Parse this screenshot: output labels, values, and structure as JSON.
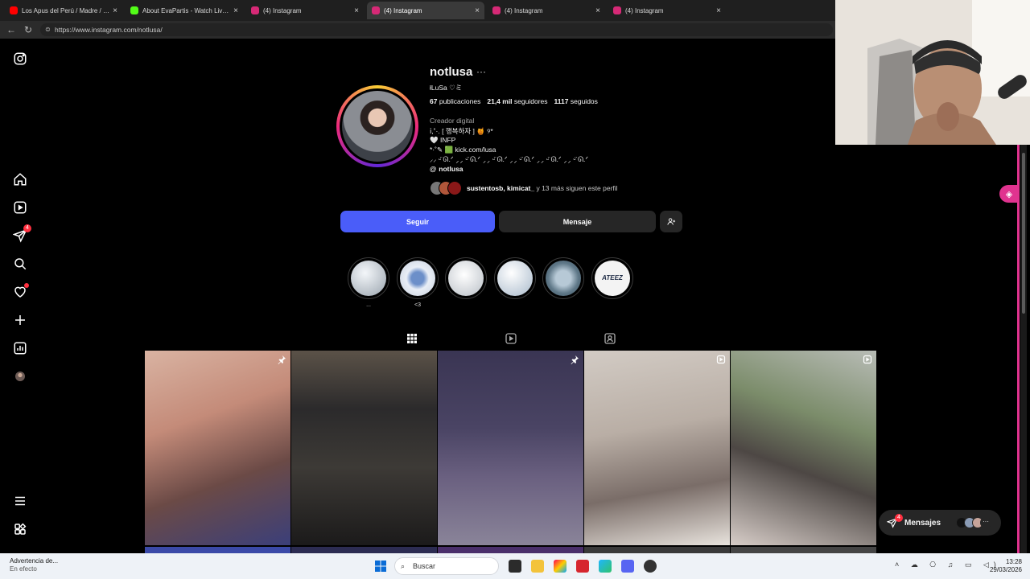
{
  "browser": {
    "tabs": [
      {
        "title": "Los Apus del Perú / Madre / vídeo",
        "fav_color": "#ff0000",
        "active": false
      },
      {
        "title": "About EvaPartis - Watch Live on Ki",
        "fav_color": "#53fc18",
        "active": false
      },
      {
        "title": "(4) Instagram",
        "fav_color": "#d62976",
        "active": false
      },
      {
        "title": "(4) Instagram",
        "fav_color": "#d62976",
        "active": true
      },
      {
        "title": "(4) Instagram",
        "fav_color": "#d62976",
        "active": false
      },
      {
        "title": "(4) Instagram",
        "fav_color": "#d62976",
        "active": false
      },
      {
        "title": "(4) Instagram",
        "fav_color": "#d62976",
        "active": false
      }
    ],
    "url": "https://www.instagram.com/notlusa/"
  },
  "sidebar": {
    "notifications_badge": "4"
  },
  "profile": {
    "username": "notlusa",
    "more": "···",
    "full_name": "łLuSa ♡ミ",
    "stats": {
      "posts_count": "67",
      "posts_label": "publicaciones",
      "followers_count": "21,4 mil",
      "followers_label": "seguidores",
      "following_count": "1117",
      "following_label": "seguidos"
    },
    "category": "Creador digital",
    "bio_lines": [
      "ⅰ,˚·. [ 행복하자 ] 🍯 ୨*",
      "🤍 INFP",
      "*·˚✎ 🟩 kick.com/lusa",
      "⸝⸝ ᵕ̈ ᘏ.ᐟ ⸝⸝ ᵕ̈ ᘏ.ᐟ ⸝⸝ ᵕ̈ ᘏ.ᐟ ⸝⸝ ᵕ̈ ᘏ.ᐟ ⸝⸝ ᵕ̈ ᘏ.ᐟ ⸝⸝ ᵕ̈ ᘏ.ᐟ"
    ],
    "threads_handle": "notlusa",
    "followed_by_names": "sustentosb, kimicat_",
    "followed_by_rest": " y 13 más siguen este perfil"
  },
  "actions": {
    "follow_label": "Seguir",
    "message_label": "Mensaje",
    "suggest_icon": "add-person-icon"
  },
  "highlights": [
    {
      "label": "...",
      "color": "#cfd6dd"
    },
    {
      "label": "<3",
      "color": "#b8c8e8"
    },
    {
      "label": "",
      "color": "#e3e6ea"
    },
    {
      "label": "",
      "color": "#dfe7ef"
    },
    {
      "label": "",
      "color": "#8fa6b6"
    },
    {
      "label": "",
      "color": "#f2f2f2"
    }
  ],
  "highlight_6_text": "ATEEZ",
  "messages": {
    "label": "Mensajes",
    "badge": "4"
  },
  "taskbar": {
    "weather_title": "Advertencia de...",
    "weather_sub": "En efecto",
    "search_placeholder": "Buscar",
    "time": "13:28",
    "date": "29/03/2026"
  }
}
